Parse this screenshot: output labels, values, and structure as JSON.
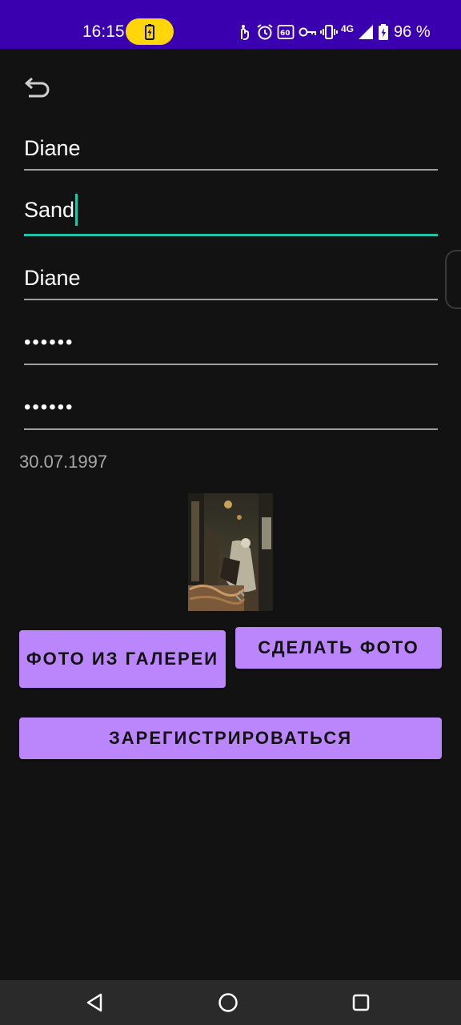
{
  "status_bar": {
    "time": "16:15",
    "network": "4G",
    "battery_percent": "96 %",
    "background": "#3a00b0",
    "battery_pill_color": "#ffd60a",
    "icons": [
      "battery-charging-icon",
      "accessibility-icon",
      "alarm-icon",
      "sixty-hz-icon",
      "vpn-key-icon",
      "vibrate-icon",
      "signal-icon",
      "battery-icon"
    ]
  },
  "form": {
    "back_icon": "back-arrow-icon",
    "first_name": "Diane",
    "last_name": "Sand",
    "login": "Diane",
    "password": "••••••",
    "password_confirm": "••••••",
    "birth_date": "30.07.1997",
    "accent_color": "#20c4a8"
  },
  "buttons": {
    "gallery": "ФОТО ИЗ ГАЛЕРЕИ",
    "camera": "СДЕЛАТЬ ФОТО",
    "register": "ЗАРЕГИСТРИРОВАТЬСЯ",
    "color": "#bb86fc"
  },
  "nav_bar": {
    "icons": [
      "nav-back-icon",
      "nav-home-icon",
      "nav-recents-icon"
    ]
  }
}
